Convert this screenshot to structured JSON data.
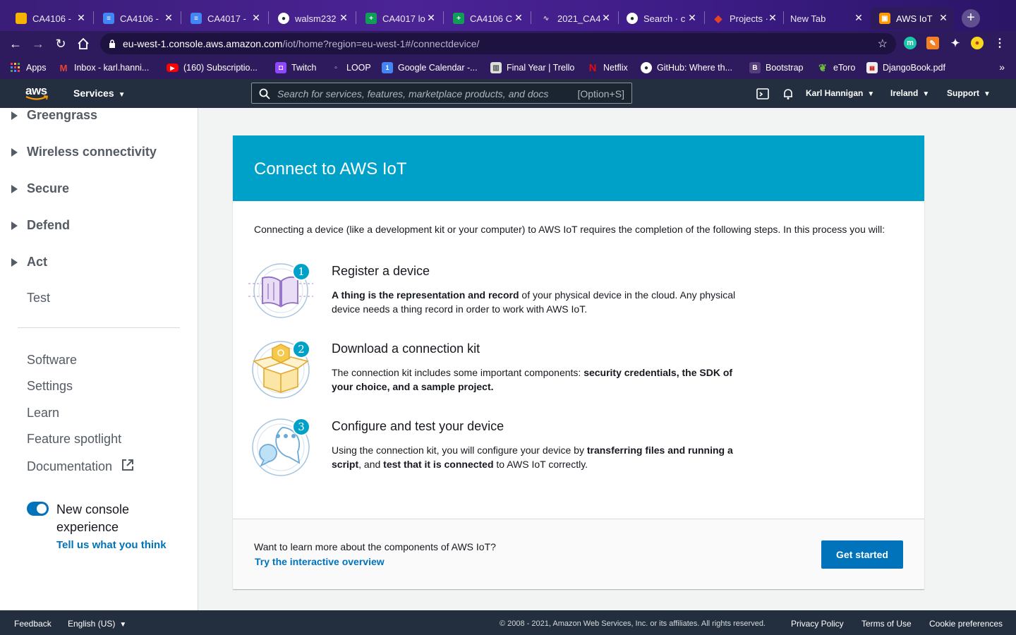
{
  "browser": {
    "tabs": [
      {
        "title": "CA4106 -",
        "icon": "slides-icon",
        "color": "#f4b400"
      },
      {
        "title": "CA4106 -",
        "icon": "docs-icon",
        "color": "#4285f4"
      },
      {
        "title": "CA4017 -",
        "icon": "docs-icon",
        "color": "#4285f4"
      },
      {
        "title": "walsm232",
        "icon": "github-icon",
        "color": "#24292e"
      },
      {
        "title": "CA4017 lo",
        "icon": "sheets-icon",
        "color": "#0f9d58"
      },
      {
        "title": "CA4106 C",
        "icon": "sheets-icon",
        "color": "#0f9d58"
      },
      {
        "title": "2021_CA4",
        "icon": "waveform-icon",
        "color": "#555555"
      },
      {
        "title": "Search · c",
        "icon": "github-icon",
        "color": "#24292e"
      },
      {
        "title": "Projects ·",
        "icon": "gitlab-icon",
        "color": "#e24329"
      },
      {
        "title": "New Tab",
        "icon": "",
        "color": ""
      },
      {
        "title": "AWS IoT",
        "icon": "aws-iot-icon",
        "color": "#ff9900"
      }
    ],
    "url_host": "eu-west-1.console.aws.amazon.com",
    "url_path": "/iot/home?region=eu-west-1#/connectdevice/",
    "bookmarks": [
      {
        "label": "Apps",
        "icon": "apps-grid-icon"
      },
      {
        "label": "Inbox - karl.hanni...",
        "icon": "gmail-icon"
      },
      {
        "label": "(160) Subscriptio...",
        "icon": "youtube-icon"
      },
      {
        "label": "Twitch",
        "icon": "twitch-icon"
      },
      {
        "label": "LOOP",
        "icon": "loop-icon"
      },
      {
        "label": "Google Calendar -...",
        "icon": "calendar-icon"
      },
      {
        "label": "Final Year | Trello",
        "icon": "trello-icon"
      },
      {
        "label": "Netflix",
        "icon": "netflix-icon"
      },
      {
        "label": "GitHub: Where th...",
        "icon": "github-icon"
      },
      {
        "label": "Bootstrap",
        "icon": "bootstrap-icon"
      },
      {
        "label": "eToro",
        "icon": "etoro-icon"
      },
      {
        "label": "DjangoBook.pdf",
        "icon": "pdf-icon"
      }
    ],
    "bookmarks_more": "»"
  },
  "aws_header": {
    "logo": "aws",
    "services": "Services",
    "search_placeholder": "Search for services, features, marketplace products, and docs",
    "search_shortcut": "[Option+S]",
    "user": "Karl Hannigan",
    "region": "Ireland",
    "support": "Support"
  },
  "sidebar": {
    "groups": [
      "Greengrass",
      "Wireless connectivity",
      "Secure",
      "Defend",
      "Act"
    ],
    "test": "Test",
    "links": [
      "Software",
      "Settings",
      "Learn",
      "Feature spotlight",
      "Documentation"
    ],
    "toggle_label": "New console experience",
    "toggle_on": true,
    "feedback": "Tell us what you think"
  },
  "main": {
    "title": "Connect to AWS IoT",
    "intro": "Connecting a device (like a development kit or your computer) to AWS IoT requires the completion of the following steps. In this process you will:",
    "steps": [
      {
        "number": "1",
        "title": "Register a device",
        "bold1": "A thing is the representation and record",
        "text1": " of your physical device in the cloud. Any physical device needs a thing record in order to work with AWS IoT."
      },
      {
        "number": "2",
        "title": "Download a connection kit",
        "text1": "The connection kit includes some important components: ",
        "bold1": "security credentials, the SDK of your choice, and a sample project."
      },
      {
        "number": "3",
        "title": "Configure and test your device",
        "text1": "Using the connection kit, you will configure your device by ",
        "bold1": "transferring files and running a script",
        "text2": ", and ",
        "bold2": "test that it is connected",
        "text3": " to AWS IoT correctly."
      }
    ],
    "footer_question": "Want to learn more about the components of AWS IoT?",
    "footer_link": "Try the interactive overview",
    "cta": "Get started"
  },
  "footer": {
    "feedback": "Feedback",
    "language": "English (US)",
    "copyright": "© 2008 - 2021, Amazon Web Services, Inc. or its affiliates. All rights reserved.",
    "privacy": "Privacy Policy",
    "terms": "Terms of Use",
    "cookies": "Cookie preferences"
  }
}
